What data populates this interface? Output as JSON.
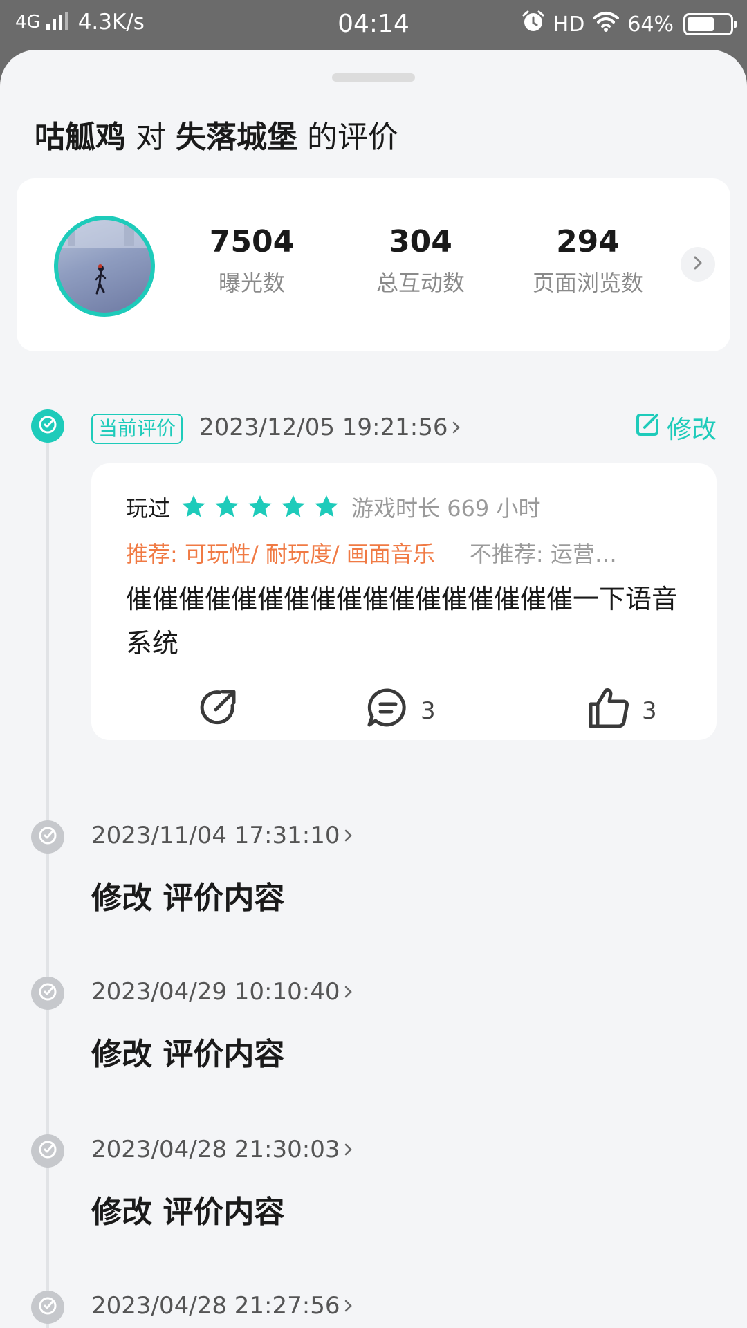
{
  "status_bar": {
    "network": "4G",
    "speed": "4.3K/s",
    "time": "04:14",
    "hd": "HD",
    "battery": "64%",
    "battery_level": 0.64
  },
  "sheet": {
    "title": {
      "user": "咕觚鸡",
      "connector": "对",
      "game": "失落城堡",
      "suffix": "的评价"
    }
  },
  "stats": [
    {
      "value": "7504",
      "label": "曝光数"
    },
    {
      "value": "304",
      "label": "总互动数"
    },
    {
      "value": "294",
      "label": "页面浏览数"
    }
  ],
  "current": {
    "badge": "当前评价",
    "date": "2023/12/05 19:21:56",
    "edit_label": "修改",
    "review": {
      "played": "玩过",
      "stars": 5,
      "playtime": "游戏时长 669 小时",
      "recommend": "推荐: 可玩性/ 耐玩度/ 画面音乐",
      "not_recommend": "不推荐: 运营…",
      "text": "催催催催催催催催催催催催催催催催催一下语音系统",
      "comments": "3",
      "likes": "3"
    }
  },
  "history": [
    {
      "date": "2023/11/04 17:31:10",
      "title": "修改 评价内容"
    },
    {
      "date": "2023/04/29 10:10:40",
      "title": "修改 评价内容"
    },
    {
      "date": "2023/04/28 21:30:03",
      "title": "修改 评价内容"
    },
    {
      "date": "2023/04/28 21:27:56"
    }
  ],
  "colors": {
    "accent": "#1ecbba",
    "recommend": "#f07a44",
    "star": "#1ecbba"
  },
  "icons": {
    "edit": "edit-icon",
    "share": "share-icon",
    "comment": "comment-icon",
    "like": "thumbs-up-icon"
  }
}
